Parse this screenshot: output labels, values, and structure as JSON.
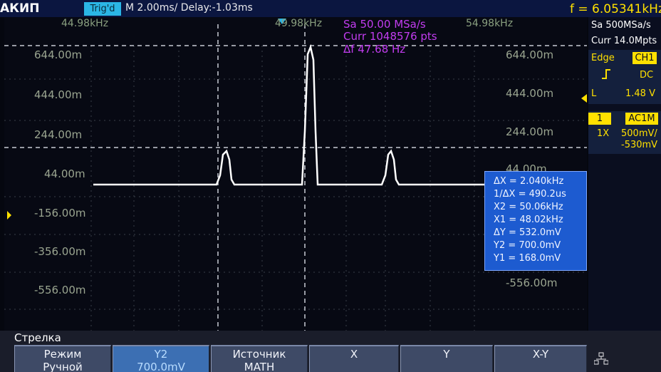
{
  "header": {
    "brand": "АКИП",
    "trig_status": "Trig'd",
    "timebase": "M 2.00ms/ Delay:-1.03ms",
    "frequency": "f = 6.05341kHz"
  },
  "plot": {
    "freq_labels": [
      "44.98kHz",
      "49.98kHz",
      "54.98kHz"
    ],
    "y_labels_left": [
      "644.00m",
      "444.00m",
      "244.00m",
      "44.00m",
      "-156.00m",
      "-356.00m",
      "-556.00m"
    ],
    "y_labels_right": [
      "644.00m",
      "444.00m",
      "244.00m",
      "44.00m",
      "-556.00m"
    ],
    "measurements": [
      "Sa 50.00 MSa/s",
      "Curr 1048576 pts",
      "Δf 47.68 Hz"
    ],
    "cursor_readout": [
      "ΔX = 2.040kHz",
      "1/ΔX = 490.2us",
      "X2 = 50.06kHz",
      "X1 = 48.02kHz",
      "ΔY = 532.0mV",
      "Y2 = 700.0mV",
      "Y1 = 168.0mV"
    ],
    "colors": {
      "trace": "#ffffff",
      "grid": "#3a4048",
      "cursor": "#c8ccd4",
      "math_text": "#c23cf0",
      "channel": "#ffe000"
    }
  },
  "right_panel": {
    "sample_rate": "Sa 500MSa/s",
    "memory": "Curr 14.0Mpts",
    "trigger_type": "Edge",
    "trigger_source": "CH1",
    "slope_icon": "rising-edge-icon",
    "coupling": "DC",
    "level_label": "L",
    "level_value": "1.48 V",
    "channel_num": "1",
    "channel_badge": "AC1M",
    "probe": "1X",
    "volts_div": "500mV/",
    "offset": "-530mV"
  },
  "softkeys": {
    "title": "Стрелка",
    "items": [
      {
        "line1": "Режим",
        "line2": "Ручной"
      },
      {
        "line1": "Y2",
        "line2": "700.0mV"
      },
      {
        "line1": "Источник",
        "line2": "MATH"
      },
      {
        "label": "X"
      },
      {
        "label": "Y"
      },
      {
        "label": "X-Y"
      },
      {
        "label": "network-icon"
      }
    ]
  }
}
